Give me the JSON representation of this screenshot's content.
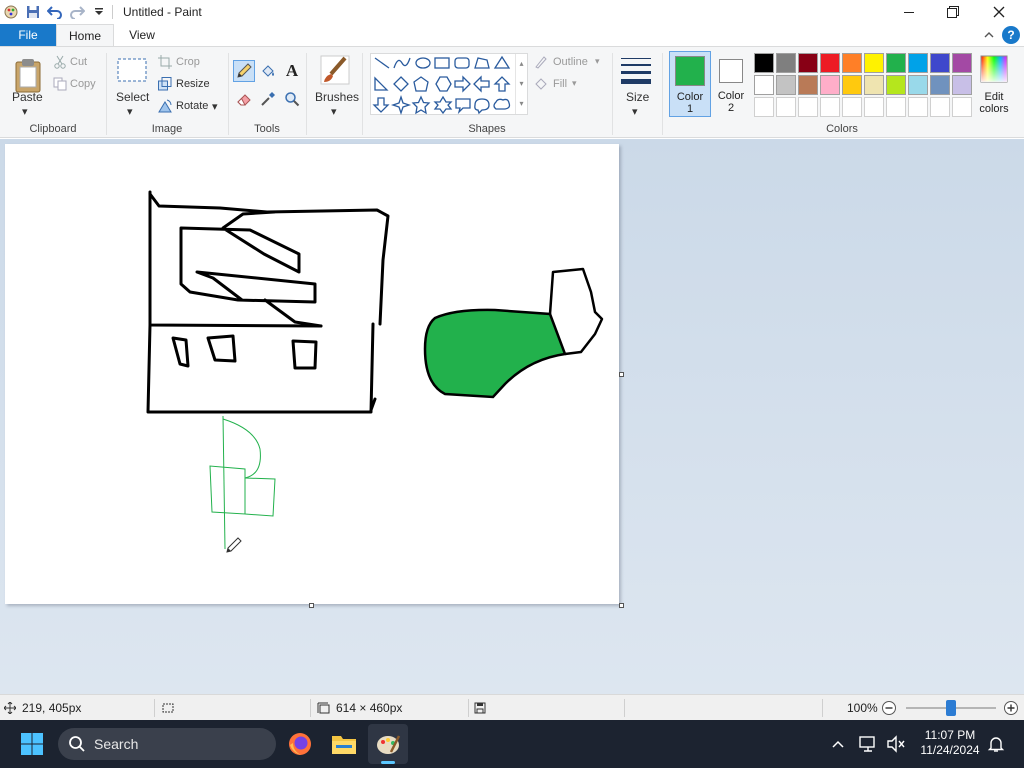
{
  "window": {
    "title": "Untitled - Paint"
  },
  "tabs": {
    "file": "File",
    "home": "Home",
    "view": "View",
    "help": "?"
  },
  "clipboard": {
    "paste": "Paste",
    "cut": "Cut",
    "copy": "Copy",
    "group": "Clipboard"
  },
  "image": {
    "select": "Select",
    "crop": "Crop",
    "resize": "Resize",
    "rotate": "Rotate",
    "group": "Image"
  },
  "tools": {
    "group": "Tools",
    "text_glyph": "A"
  },
  "brushes": {
    "label": "Brushes"
  },
  "shapes": {
    "outline": "Outline",
    "fill": "Fill",
    "group": "Shapes"
  },
  "size": {
    "label": "Size"
  },
  "colors": {
    "color1_a": "Color",
    "color1_b": "1",
    "color2_a": "Color",
    "color2_b": "2",
    "color1_value": "#22b14c",
    "color2_value": "#ffffff",
    "edit_a": "Edit",
    "edit_b": "colors",
    "group": "Colors",
    "palette_row1": [
      "#000000",
      "#7f7f7f",
      "#880015",
      "#ed1c24",
      "#ff7f27",
      "#fff200",
      "#22b14c",
      "#00a2e8",
      "#3f48cc",
      "#a349a4"
    ],
    "palette_row2": [
      "#ffffff",
      "#c3c3c3",
      "#b97a57",
      "#ffaec9",
      "#ffc90e",
      "#efe4b0",
      "#b5e61d",
      "#99d9ea",
      "#7092be",
      "#c8bfe7"
    ]
  },
  "status": {
    "cursor_pos": "219, 405px",
    "canvas_size": "614 × 460px",
    "zoom": "100%",
    "zoom_level": 0.5
  },
  "taskbar": {
    "search": "Search",
    "time": "11:07 PM",
    "date": "11/24/2024"
  }
}
